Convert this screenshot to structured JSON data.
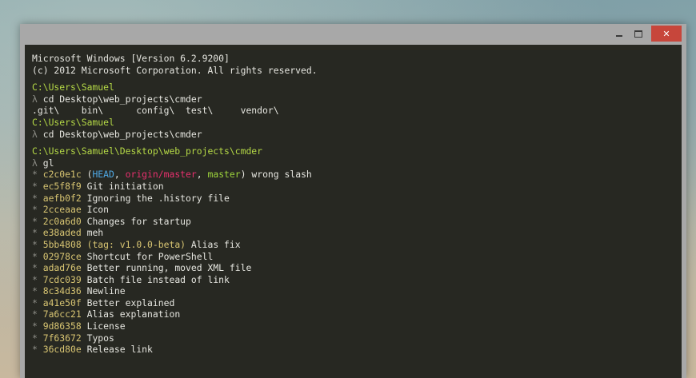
{
  "window": {
    "minimize_glyph": "",
    "maximize_glyph": "",
    "close_glyph": "✕"
  },
  "console": {
    "header": [
      "Microsoft Windows [Version 6.2.9200]",
      "(c) 2012 Microsoft Corporation. All rights reserved."
    ],
    "prompt_symbol": "λ",
    "session": [
      {
        "path": "C:\\Users\\Samuel",
        "command": "cd Desktop\\web_projects\\cmder"
      },
      {
        "output": ".git\\    bin\\      config\\  test\\     vendor\\"
      },
      {
        "path": "C:\\Users\\Samuel",
        "command": "cd Desktop\\web_projects\\cmder"
      },
      {
        "path": "C:\\Users\\Samuel\\Desktop\\web_projects\\cmder",
        "command": "gl"
      }
    ],
    "git_log": [
      {
        "hash": "c2c0e1c",
        "refs": {
          "head": "HEAD",
          "origin": "origin/master",
          "branch": "master"
        },
        "message": "wrong slash"
      },
      {
        "hash": "ec5f8f9",
        "message": "Git initiation"
      },
      {
        "hash": "aefb0f2",
        "message": "Ignoring the .history file"
      },
      {
        "hash": "2cceaae",
        "message": "Icon"
      },
      {
        "hash": "2c0a6d0",
        "message": "Changes for startup"
      },
      {
        "hash": "e38aded",
        "message": "meh"
      },
      {
        "hash": "5bb4808",
        "tag": "tag: v1.0.0-beta",
        "message": "Alias fix"
      },
      {
        "hash": "02978ce",
        "message": "Shortcut for PowerShell"
      },
      {
        "hash": "adad76e",
        "message": "Better running, moved XML file"
      },
      {
        "hash": "7cdc039",
        "message": "Batch file instead of link"
      },
      {
        "hash": "8c34d36",
        "message": "Newline"
      },
      {
        "hash": "a41e50f",
        "message": "Better explained"
      },
      {
        "hash": "7a6cc21",
        "message": "Alias explanation"
      },
      {
        "hash": "9d86358",
        "message": "License"
      },
      {
        "hash": "7f63672",
        "message": "Typos"
      },
      {
        "hash": "36cd80e",
        "message": "Release link"
      }
    ],
    "log_bullet": "*",
    "colors": {
      "background": "#272822",
      "path": "#b5d946",
      "hash": "#d8c572",
      "head": "#4fa9e5",
      "origin": "#e8306e",
      "branch": "#9fd63c",
      "close_button": "#c7463b"
    }
  }
}
